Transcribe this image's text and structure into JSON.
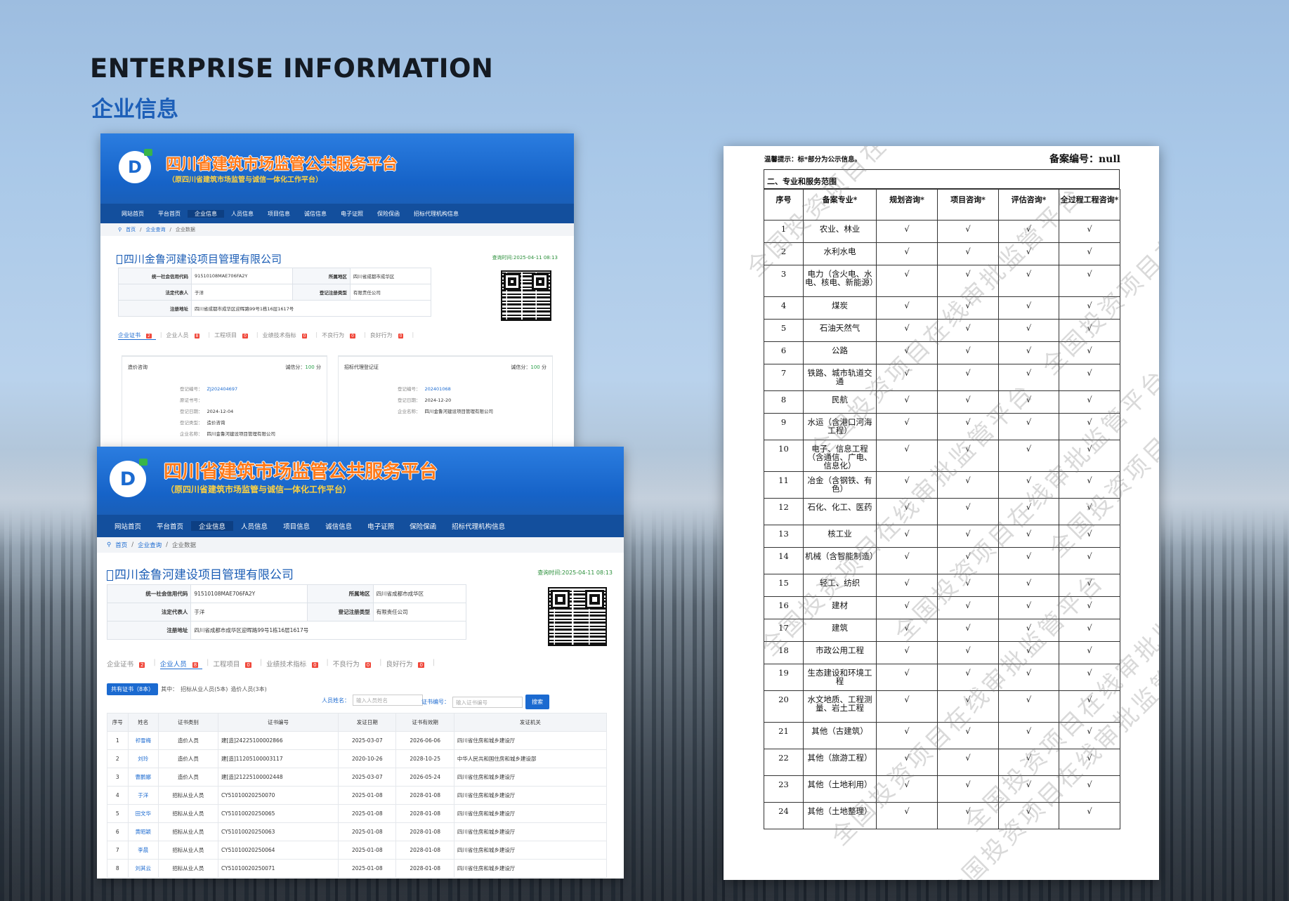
{
  "heading": {
    "en": "ENTERPRISE INFORMATION",
    "cn": "企业信息"
  },
  "platform": {
    "title": "四川省建筑市场监管公共服务平台",
    "subtitle": "（原四川省建筑市场监管与诚信一体化工作平台）",
    "nav": [
      "网站首页",
      "平台首页",
      "企业信息",
      "人员信息",
      "项目信息",
      "诚信信息",
      "电子证照",
      "保险保函",
      "招标代理机构信息"
    ],
    "breadcrumb": [
      "首页",
      "企业查询",
      "企业数据"
    ],
    "company_name": "四川金鲁河建设项目管理有限公司",
    "query_time": "查询时间:2025-04-11 08:13",
    "info": {
      "credit_code_label": "统一社会信用代码",
      "credit_code": "91510108MAE706FA2Y",
      "region_label": "所属地区",
      "region": "四川省成都市成华区",
      "legal_label": "法定代表人",
      "legal": "于洋",
      "type_label": "登记注册类型",
      "type": "有限责任公司",
      "address_label": "注册地址",
      "address": "四川省成都市成华区迎晖路99号1栋16层1617号"
    },
    "tabs": [
      {
        "label": "企业证书",
        "count": "2"
      },
      {
        "label": "企业人员",
        "count": "8"
      },
      {
        "label": "工程项目",
        "count": "0"
      },
      {
        "label": "业绩技术指标",
        "count": "0"
      },
      {
        "label": "不良行为",
        "count": "0"
      },
      {
        "label": "良好行为",
        "count": "0"
      }
    ],
    "cert_cards": [
      {
        "title": "造价咨询",
        "score_label": "诚信分：",
        "score": "100",
        "score_unit": "分",
        "rows": [
          {
            "k": "登记编号：",
            "v": "ZJ202404697"
          },
          {
            "k": "原证书号：",
            "v": ""
          },
          {
            "k": "登记日期：",
            "v": "2024-12-04"
          },
          {
            "k": "登记类型：",
            "v": "造价咨询"
          },
          {
            "k": "企业名称：",
            "v": "四川金鲁河建设项目管理有限公司"
          }
        ]
      },
      {
        "title": "招标代理登记证",
        "score_label": "诚信分：",
        "score": "100",
        "score_unit": "分",
        "rows": [
          {
            "k": "登记编号：",
            "v": "202401068"
          },
          {
            "k": "登记日期：",
            "v": "2024-12-20"
          },
          {
            "k": "企业名称：",
            "v": "四川金鲁河建设项目管理有限公司"
          }
        ]
      }
    ],
    "summary": {
      "pill": "共有证书（8本）",
      "in": "其中：",
      "a": "招标从业人员(5本)",
      "b": "造价人员(3本)"
    },
    "search": {
      "name_label": "人员姓名：",
      "name_ph": "输入人员姓名",
      "cert_label": "证书编号：",
      "cert_ph": "输入证书编号",
      "button": "搜索"
    },
    "people_headers": [
      "序号",
      "姓名",
      "证书类别",
      "证书编号",
      "发证日期",
      "证书有效期",
      "发证机关"
    ],
    "people": [
      [
        "1",
        "祁雪梅",
        "造价人员",
        "建[造]24225100002866",
        "2025-03-07",
        "2026-06-06",
        "四川省住房和城乡建设厅"
      ],
      [
        "2",
        "刘玲",
        "造价人员",
        "建[造]11205100003117",
        "2020-10-26",
        "2028-10-25",
        "中华人民共和国住房和城乡建设部"
      ],
      [
        "3",
        "曹鹏娜",
        "造价人员",
        "建[造]21225100002448",
        "2025-03-07",
        "2026-05-24",
        "四川省住房和城乡建设厅"
      ],
      [
        "4",
        "于洋",
        "招标从业人员",
        "CY51010020250070",
        "2025-01-08",
        "2028-01-08",
        "四川省住房和城乡建设厅"
      ],
      [
        "5",
        "田文华",
        "招标从业人员",
        "CY51010020250065",
        "2025-01-08",
        "2028-01-08",
        "四川省住房和城乡建设厅"
      ],
      [
        "6",
        "黄昭颖",
        "招标从业人员",
        "CY51010020250063",
        "2025-01-08",
        "2028-01-08",
        "四川省住房和城乡建设厅"
      ],
      [
        "7",
        "李晨",
        "招标从业人员",
        "CY51010020250064",
        "2025-01-08",
        "2028-01-08",
        "四川省住房和城乡建设厅"
      ],
      [
        "8",
        "刘其云",
        "招标从业人员",
        "CY51010020250071",
        "2025-01-08",
        "2028-01-08",
        "四川省住房和城乡建设厅"
      ]
    ]
  },
  "document": {
    "hint": "温馨提示：标*部分为公示信息。",
    "record_no": "备案编号：null",
    "section": "二、专业和服务范围",
    "headers": [
      "序号",
      "备案专业*",
      "规划咨询*",
      "项目咨询*",
      "评估咨询*",
      "全过程工程咨询*"
    ],
    "check": "√",
    "watermark": "全国投资项目在线审批监管平台",
    "rows": [
      {
        "no": "1",
        "major": "农业、林业"
      },
      {
        "no": "2",
        "major": "水利水电"
      },
      {
        "no": "3",
        "major": "电力（含火电、水电、核电、新能源）"
      },
      {
        "no": "4",
        "major": "煤炭"
      },
      {
        "no": "5",
        "major": "石油天然气"
      },
      {
        "no": "6",
        "major": "公路"
      },
      {
        "no": "7",
        "major": "铁路、城市轨道交通"
      },
      {
        "no": "8",
        "major": "民航"
      },
      {
        "no": "9",
        "major": "水运（含港口河海工程）"
      },
      {
        "no": "10",
        "major": "电子、信息工程（含通信、广电、信息化）"
      },
      {
        "no": "11",
        "major": "冶金（含钢铁、有色）"
      },
      {
        "no": "12",
        "major": "石化、化工、医药"
      },
      {
        "no": "13",
        "major": "核工业"
      },
      {
        "no": "14",
        "major": "机械（含智能制造）"
      },
      {
        "no": "15",
        "major": "轻工、纺织"
      },
      {
        "no": "16",
        "major": "建材"
      },
      {
        "no": "17",
        "major": "建筑"
      },
      {
        "no": "18",
        "major": "市政公用工程"
      },
      {
        "no": "19",
        "major": "生态建设和环境工程"
      },
      {
        "no": "20",
        "major": "水文地质、工程测量、岩土工程"
      },
      {
        "no": "21",
        "major": "其他（古建筑）"
      },
      {
        "no": "22",
        "major": "其他（旅游工程）"
      },
      {
        "no": "23",
        "major": "其他（土地利用）"
      },
      {
        "no": "24",
        "major": "其他（土地整理）"
      }
    ]
  }
}
